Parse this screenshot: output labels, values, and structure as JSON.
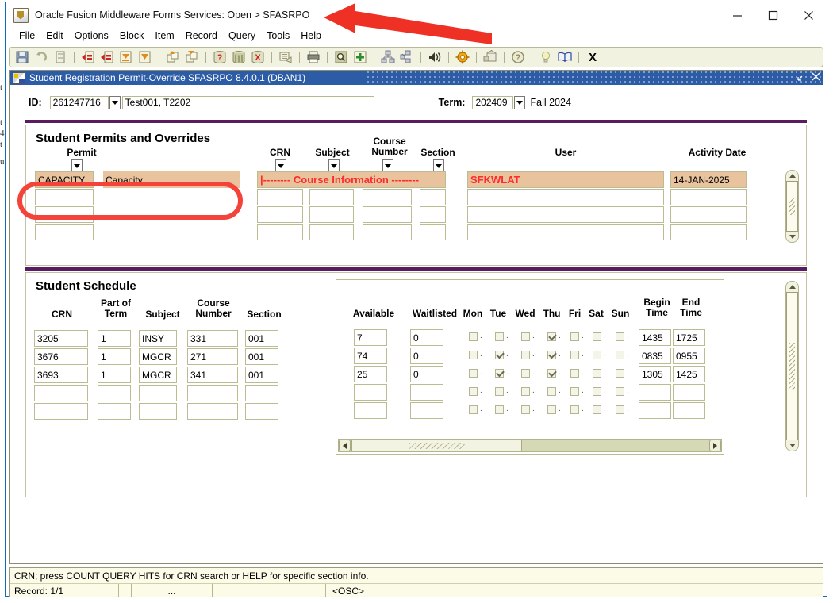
{
  "window": {
    "title": "Oracle Fusion Middleware Forms Services:  Open > SFASRPO",
    "icon": "java-coffee-icon",
    "minimize": "minimize-icon",
    "maximize": "maximize-icon",
    "close": "close-icon"
  },
  "menubar": [
    {
      "label": "File",
      "accel": "F"
    },
    {
      "label": "Edit",
      "accel": "E"
    },
    {
      "label": "Options",
      "accel": "O"
    },
    {
      "label": "Block",
      "accel": "B"
    },
    {
      "label": "Item",
      "accel": "I"
    },
    {
      "label": "Record",
      "accel": "R"
    },
    {
      "label": "Query",
      "accel": "Q"
    },
    {
      "label": "Tools",
      "accel": "T"
    },
    {
      "label": "Help",
      "accel": "H"
    }
  ],
  "toolbar": {
    "items": [
      {
        "name": "save-icon",
        "type": "icon"
      },
      {
        "name": "rollback-undo-icon",
        "type": "icon"
      },
      {
        "name": "select-document-icon",
        "type": "icon"
      },
      {
        "name": "separator",
        "type": "sep"
      },
      {
        "name": "insert-record-icon",
        "type": "icon"
      },
      {
        "name": "remove-record-icon",
        "type": "icon"
      },
      {
        "name": "previous-record-icon",
        "type": "icon"
      },
      {
        "name": "next-record-icon",
        "type": "icon"
      },
      {
        "name": "separator",
        "type": "sep"
      },
      {
        "name": "previous-block-icon",
        "type": "icon"
      },
      {
        "name": "next-block-icon",
        "type": "icon"
      },
      {
        "name": "separator",
        "type": "sep"
      },
      {
        "name": "enter-query-icon",
        "type": "icon"
      },
      {
        "name": "execute-query-icon",
        "type": "icon"
      },
      {
        "name": "cancel-query-icon",
        "type": "icon"
      },
      {
        "name": "separator",
        "type": "sep"
      },
      {
        "name": "print-screen-icon",
        "type": "icon"
      },
      {
        "name": "separator",
        "type": "sep"
      },
      {
        "name": "print-icon",
        "type": "icon"
      },
      {
        "name": "separator",
        "type": "sep"
      },
      {
        "name": "search-query-icon",
        "type": "icon"
      },
      {
        "name": "add-record-icon",
        "type": "icon"
      },
      {
        "name": "separator",
        "type": "sep"
      },
      {
        "name": "expand-all-icon",
        "type": "icon"
      },
      {
        "name": "collapse-all-icon",
        "type": "icon"
      },
      {
        "name": "separator",
        "type": "sep"
      },
      {
        "name": "volume-sound-icon",
        "type": "icon"
      },
      {
        "name": "separator",
        "type": "sep"
      },
      {
        "name": "target-crosshair-icon",
        "type": "icon"
      },
      {
        "name": "separator",
        "type": "sep"
      },
      {
        "name": "workflow-icon",
        "type": "icon"
      },
      {
        "name": "separator",
        "type": "sep"
      },
      {
        "name": "help-question-icon",
        "type": "icon"
      },
      {
        "name": "separator",
        "type": "sep"
      },
      {
        "name": "lightbulb-hint-icon",
        "type": "icon"
      },
      {
        "name": "open-book-icon",
        "type": "icon"
      },
      {
        "name": "separator",
        "type": "sep"
      },
      {
        "name": "exit-x-icon",
        "type": "text",
        "label": "X"
      }
    ],
    "exit_label": "X"
  },
  "form": {
    "title": "Student Registration Permit-Override  SFASRPO  8.4.0.1  (DBAN1)",
    "restore_icon": "restore-down-icon",
    "close_icon": "close-icon"
  },
  "key_block": {
    "id_label": "ID:",
    "id_value": "261247716",
    "student_name": "Test001, T2202",
    "term_label": "Term:",
    "term_value": "202409",
    "term_desc": "Fall 2024"
  },
  "permits": {
    "section_title": "Student Permits and Overrides",
    "headers": {
      "permit": "Permit",
      "crn": "CRN",
      "subject": "Subject",
      "course_number": "Course\nNumber",
      "section": "Section",
      "user": "User",
      "activity_date": "Activity Date"
    },
    "course_info_banner": "|-------- Course Information --------",
    "rows": [
      {
        "permit_code": "CAPACITY",
        "permit_desc": "Capacity",
        "crn": "",
        "subject": "",
        "course_number": "",
        "section": "",
        "user": "SFKWLAT",
        "activity_date": "14-JAN-2025",
        "active": true
      },
      {
        "permit_code": "",
        "permit_desc": "",
        "crn": "",
        "subject": "",
        "course_number": "",
        "section": "",
        "user": "",
        "activity_date": "",
        "active": false
      },
      {
        "permit_code": "",
        "permit_desc": "",
        "crn": "",
        "subject": "",
        "course_number": "",
        "section": "",
        "user": "",
        "activity_date": "",
        "active": false
      },
      {
        "permit_code": "",
        "permit_desc": "",
        "crn": "",
        "subject": "",
        "course_number": "",
        "section": "",
        "user": "",
        "activity_date": "",
        "active": false
      }
    ]
  },
  "schedule": {
    "section_title": "Student Schedule",
    "headers": {
      "crn": "CRN",
      "part_of_term": "Part of\nTerm",
      "subject": "Subject",
      "course_number": "Course\nNumber",
      "section": "Section",
      "available": "Available",
      "waitlisted": "Waitlisted",
      "days": [
        "Mon",
        "Tue",
        "Wed",
        "Thu",
        "Fri",
        "Sat",
        "Sun"
      ],
      "begin_time": "Begin\nTime",
      "end_time": "End\nTime"
    },
    "rows": [
      {
        "crn": "3205",
        "part_of_term": "1",
        "subject": "INSY",
        "course_number": "331",
        "section": "001",
        "available": "7",
        "waitlisted": "0",
        "days": [
          false,
          false,
          false,
          true,
          false,
          false,
          false
        ],
        "begin_time": "1435",
        "end_time": "1725"
      },
      {
        "crn": "3676",
        "part_of_term": "1",
        "subject": "MGCR",
        "course_number": "271",
        "section": "001",
        "available": "74",
        "waitlisted": "0",
        "days": [
          false,
          true,
          false,
          true,
          false,
          false,
          false
        ],
        "begin_time": "0835",
        "end_time": "0955"
      },
      {
        "crn": "3693",
        "part_of_term": "1",
        "subject": "MGCR",
        "course_number": "341",
        "section": "001",
        "available": "25",
        "waitlisted": "0",
        "days": [
          false,
          true,
          false,
          true,
          false,
          false,
          false
        ],
        "begin_time": "1305",
        "end_time": "1425"
      },
      {
        "crn": "",
        "part_of_term": "",
        "subject": "",
        "course_number": "",
        "section": "",
        "available": "",
        "waitlisted": "",
        "days": [
          false,
          false,
          false,
          false,
          false,
          false,
          false
        ],
        "begin_time": "",
        "end_time": ""
      },
      {
        "crn": "",
        "part_of_term": "",
        "subject": "",
        "course_number": "",
        "section": "",
        "available": "",
        "waitlisted": "",
        "days": [
          false,
          false,
          false,
          false,
          false,
          false,
          false
        ],
        "begin_time": "",
        "end_time": ""
      }
    ]
  },
  "status": {
    "message": "CRN; press COUNT QUERY HITS for CRN search or HELP for specific section info.",
    "record": "Record: 1/1",
    "ellipsis": "...",
    "osc": "<OSC>"
  },
  "annotations": {
    "arrow": "red-arrow-pointing-at-title",
    "oval": "red-oval-highlighting-capacity-permit"
  },
  "background_text": {
    "lines": [
      "t",
      "t",
      "4",
      "t",
      "u"
    ]
  },
  "colors": {
    "accent_purple": "#5b1b60",
    "active_field": "#e8c39e",
    "annotation_red": "#f4433a",
    "red_text": "#ff2b2b",
    "title_blue": "#2b5ca5",
    "toolbar_bg": "#f2f2e0"
  }
}
